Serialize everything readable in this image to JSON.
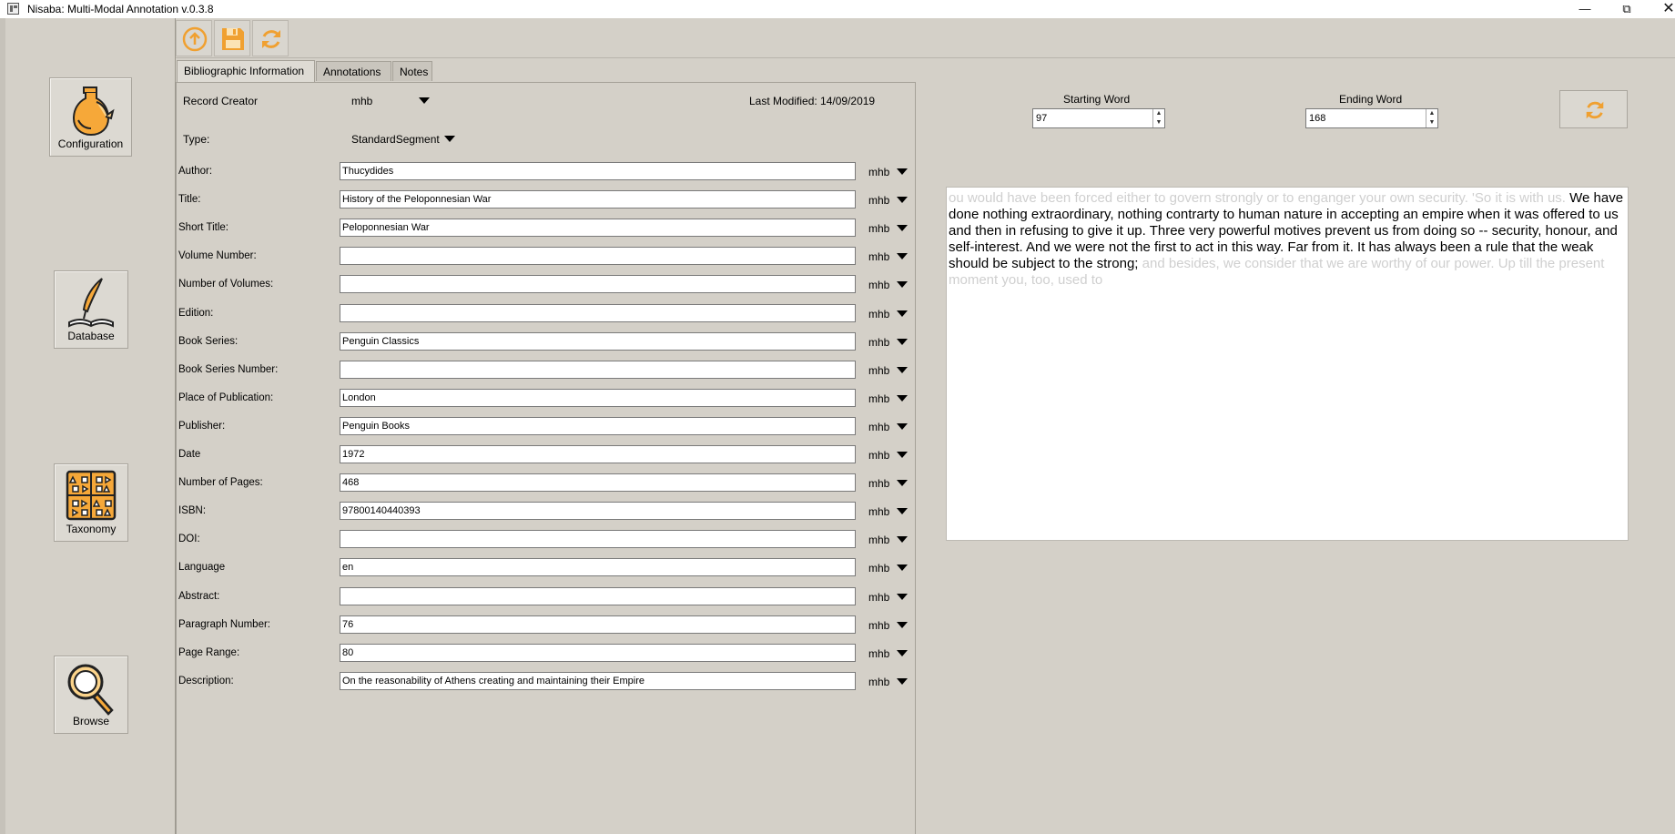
{
  "window": {
    "title": "Nisaba: Multi-Modal Annotation v.0.3.8",
    "minimize": "—",
    "maximize": "⧉",
    "close": "✕"
  },
  "sidebar": {
    "items": [
      {
        "label": "Configuration",
        "icon": "vase-icon"
      },
      {
        "label": "Database",
        "icon": "quill-book-icon"
      },
      {
        "label": "Taxonomy",
        "icon": "taxonomy-grid-icon"
      },
      {
        "label": "Browse",
        "icon": "magnifier-icon"
      }
    ]
  },
  "toolbar": {
    "buttons": [
      "upload-icon",
      "save-icon",
      "refresh-icon"
    ]
  },
  "tabs": [
    {
      "label": "Bibliographic Information",
      "active": true
    },
    {
      "label": "Annotations",
      "active": false
    },
    {
      "label": "Notes",
      "active": false
    }
  ],
  "record": {
    "creator_label": "Record Creator",
    "creator_value": "mhb",
    "last_modified": "Last Modified: 14/09/2019",
    "type_label": "Type:",
    "type_value": "StandardSegment"
  },
  "fields": [
    {
      "label": "Author:",
      "value": "Thucydides",
      "user": "mhb"
    },
    {
      "label": "Title:",
      "value": "History of the Peloponnesian War",
      "user": "mhb"
    },
    {
      "label": "Short Title:",
      "value": "Peloponnesian War",
      "user": "mhb"
    },
    {
      "label": "Volume Number:",
      "value": "",
      "user": "mhb"
    },
    {
      "label": "Number of Volumes:",
      "value": "",
      "user": "mhb"
    },
    {
      "label": "Edition:",
      "value": "",
      "user": "mhb"
    },
    {
      "label": "Book Series:",
      "value": "Penguin Classics",
      "user": "mhb"
    },
    {
      "label": "Book Series Number:",
      "value": "",
      "user": "mhb"
    },
    {
      "label": "Place of Publication:",
      "value": "London",
      "user": "mhb"
    },
    {
      "label": "Publisher:",
      "value": "Penguin Books",
      "user": "mhb"
    },
    {
      "label": "Date",
      "value": "1972",
      "user": "mhb"
    },
    {
      "label": "Number of Pages:",
      "value": "468",
      "user": "mhb"
    },
    {
      "label": "ISBN:",
      "value": "97800140440393",
      "user": "mhb"
    },
    {
      "label": "DOI:",
      "value": "",
      "user": "mhb"
    },
    {
      "label": "Language",
      "value": "en",
      "user": "mhb"
    },
    {
      "label": "Abstract:",
      "value": "",
      "user": "mhb"
    },
    {
      "label": "Paragraph Number:",
      "value": "76",
      "user": "mhb"
    },
    {
      "label": "Page Range:",
      "value": "80",
      "user": "mhb"
    },
    {
      "label": "Description:",
      "value": "On the reasonability of Athens creating and maintaining their Empire",
      "user": "mhb"
    }
  ],
  "range": {
    "starting_label": "Starting Word",
    "starting_value": "97",
    "ending_label": "Ending Word",
    "ending_value": "168"
  },
  "passage": {
    "before": "ou would have been forced either to govern strongly or to enganger your own security. 'So it is with us.",
    "selected": " We have done nothing extraordinary, nothing contrarty to human nature in accepting an empire when it was offered to us and then in refusing to give it up. Three very powerful motives prevent us from doing so -- security, honour, and self-interest. And we were not the first to act in this way. Far from it. It has always been a rule that the weak should be subject to the strong;",
    "after": " and besides, we consider that we are worthy of our power. Up till the present moment you, too, used to"
  },
  "colors": {
    "accent": "#f0a030",
    "background": "#d4d0c8"
  }
}
